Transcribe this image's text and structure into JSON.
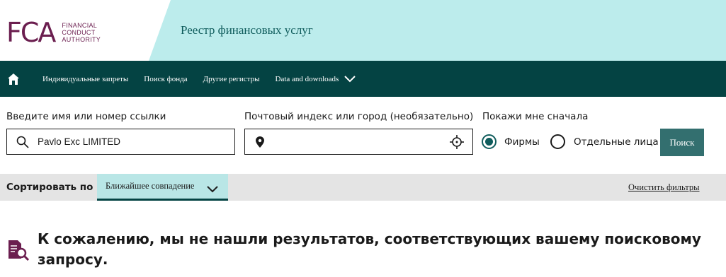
{
  "header": {
    "logo_mark": "FCA",
    "logo_lines": [
      "FINANCIAL",
      "CONDUCT",
      "AUTHORITY"
    ],
    "register_title": "Реестр финансовых услуг"
  },
  "nav": {
    "home_icon": "home-icon",
    "items": [
      {
        "label": "Индивидуальные запреты"
      },
      {
        "label": "Поиск фонда"
      },
      {
        "label": "Другие регистры"
      },
      {
        "label": "Data and downloads"
      }
    ]
  },
  "search": {
    "name_label": "Введите имя или номер ссылки",
    "name_value": "Pavlo Exc LIMITED",
    "location_label": "Почтовый индекс или город (необязательно)",
    "location_value": "",
    "show_first_label": "Покажи мне сначала",
    "options": [
      {
        "label": "Фирмы",
        "selected": true
      },
      {
        "label": "Отдельные лица",
        "selected": false
      }
    ],
    "button_label": "Поиск"
  },
  "sort": {
    "label": "Сортировать по",
    "selected": "Ближайшее совпадение",
    "clear_filters": "Очистить фильтры"
  },
  "results": {
    "message": "К сожалению, мы не нашли результатов, соответствующих вашему поисковому запросу."
  },
  "colors": {
    "brand": "#6b1e4f",
    "nav_bg": "#044343",
    "header_band": "#b9ecec",
    "button_bg": "#336f6f",
    "sort_select_bg": "#b9e6e6"
  }
}
